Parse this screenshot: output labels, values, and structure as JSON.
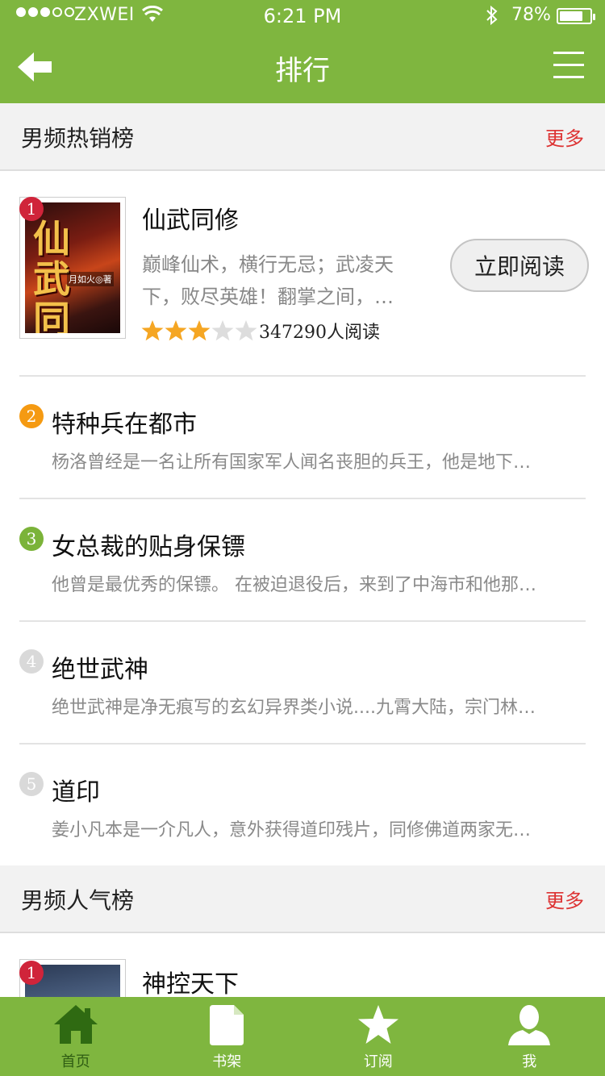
{
  "status_bar": {
    "carrier": "ZXWEI",
    "time": "6:21 PM",
    "battery": "78%",
    "battery_level": 0.78,
    "signal_bars": 3,
    "signal_total": 5
  },
  "nav": {
    "title": "排行",
    "back_icon": "arrow-left-icon",
    "menu_icon": "hamburger-menu-icon"
  },
  "sections": [
    {
      "title": "男频热销榜",
      "more": "更多",
      "featured": {
        "rank": "1",
        "title": "仙武同修",
        "cover_title": "仙武同修",
        "cover_author": "月如火◎著",
        "description": "巅峰仙术，横行无忌；武凌天下，败尽英雄！翻掌之间，…",
        "rating": 3,
        "rating_max": 5,
        "reads": "347290人阅读",
        "read_button": "立即阅读"
      },
      "items": [
        {
          "rank": "2",
          "title": "特种兵在都市",
          "snippet": "杨洛曾经是一名让所有国家军人闻名丧胆的兵王，他是地下…"
        },
        {
          "rank": "3",
          "title": "女总裁的贴身保镖",
          "snippet": "他曾是最优秀的保镖。 在被迫退役后，来到了中海市和他那…"
        },
        {
          "rank": "4",
          "title": "绝世武神",
          "snippet": "绝世武神是净无痕写的玄幻异界类小说....九霄大陆，宗门林…"
        },
        {
          "rank": "5",
          "title": "道印",
          "snippet": "姜小凡本是一介凡人，意外获得道印残片，同修佛道两家无…"
        }
      ]
    },
    {
      "title": "男频人气榜",
      "more": "更多",
      "featured": {
        "rank": "1",
        "title": "神控天下"
      }
    }
  ],
  "tabbar": {
    "tabs": [
      {
        "label": "首页",
        "icon": "home-icon",
        "active": true
      },
      {
        "label": "书架",
        "icon": "document-icon",
        "active": false
      },
      {
        "label": "订阅",
        "icon": "star-icon",
        "active": false
      },
      {
        "label": "我",
        "icon": "user-icon",
        "active": false
      }
    ]
  },
  "colors": {
    "brand_green": "#7fb63f",
    "more_red": "#dd3333",
    "star_filled": "#f5a623",
    "star_empty": "#dddddd"
  }
}
